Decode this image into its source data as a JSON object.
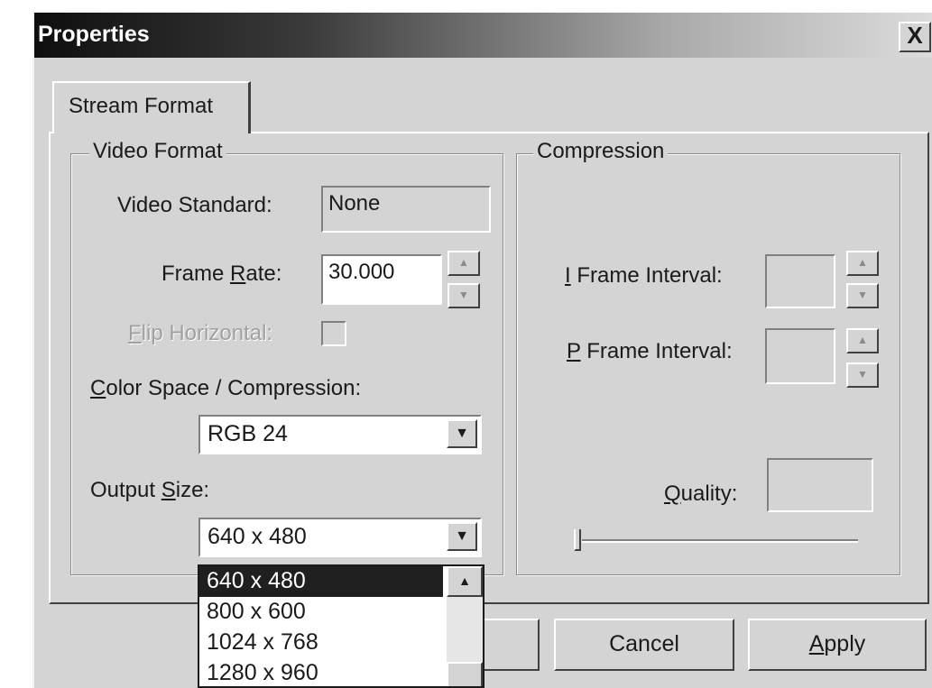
{
  "window": {
    "title": "Properties",
    "close_label": "X"
  },
  "tab": {
    "label": "Stream Format"
  },
  "video_format": {
    "legend": "Video Format",
    "video_standard_label": "Video Standard:",
    "video_standard_value": "None",
    "frame_rate_label_pre": "Frame ",
    "frame_rate_label_key": "R",
    "frame_rate_label_post": "ate:",
    "frame_rate_value": "30.000",
    "flip_label_key": "F",
    "flip_label_post": "lip Horizontal:",
    "color_space_label_key": "C",
    "color_space_label_post": "olor Space / Compression:",
    "color_space_value": "RGB 24",
    "output_size_label_pre": "Output ",
    "output_size_label_key": "S",
    "output_size_label_post": "ize:",
    "output_size_value": "640 x 480",
    "output_size_options": [
      "640 x 480",
      "800 x 600",
      "1024 x 768",
      "1280 x 960"
    ]
  },
  "compression": {
    "legend": "Compression",
    "i_frame_label_key": "I",
    "i_frame_label_post": " Frame Interval:",
    "p_frame_label_key": "P",
    "p_frame_label_post": " Frame Interval:",
    "quality_label_key": "Q",
    "quality_label_post": "uality:"
  },
  "buttons": {
    "cancel": "Cancel",
    "apply_key": "A",
    "apply_post": "pply"
  },
  "icons": {
    "spin_up": "▲",
    "spin_down": "▼",
    "combo_arrow": "▼",
    "scroll_up": "▲"
  }
}
